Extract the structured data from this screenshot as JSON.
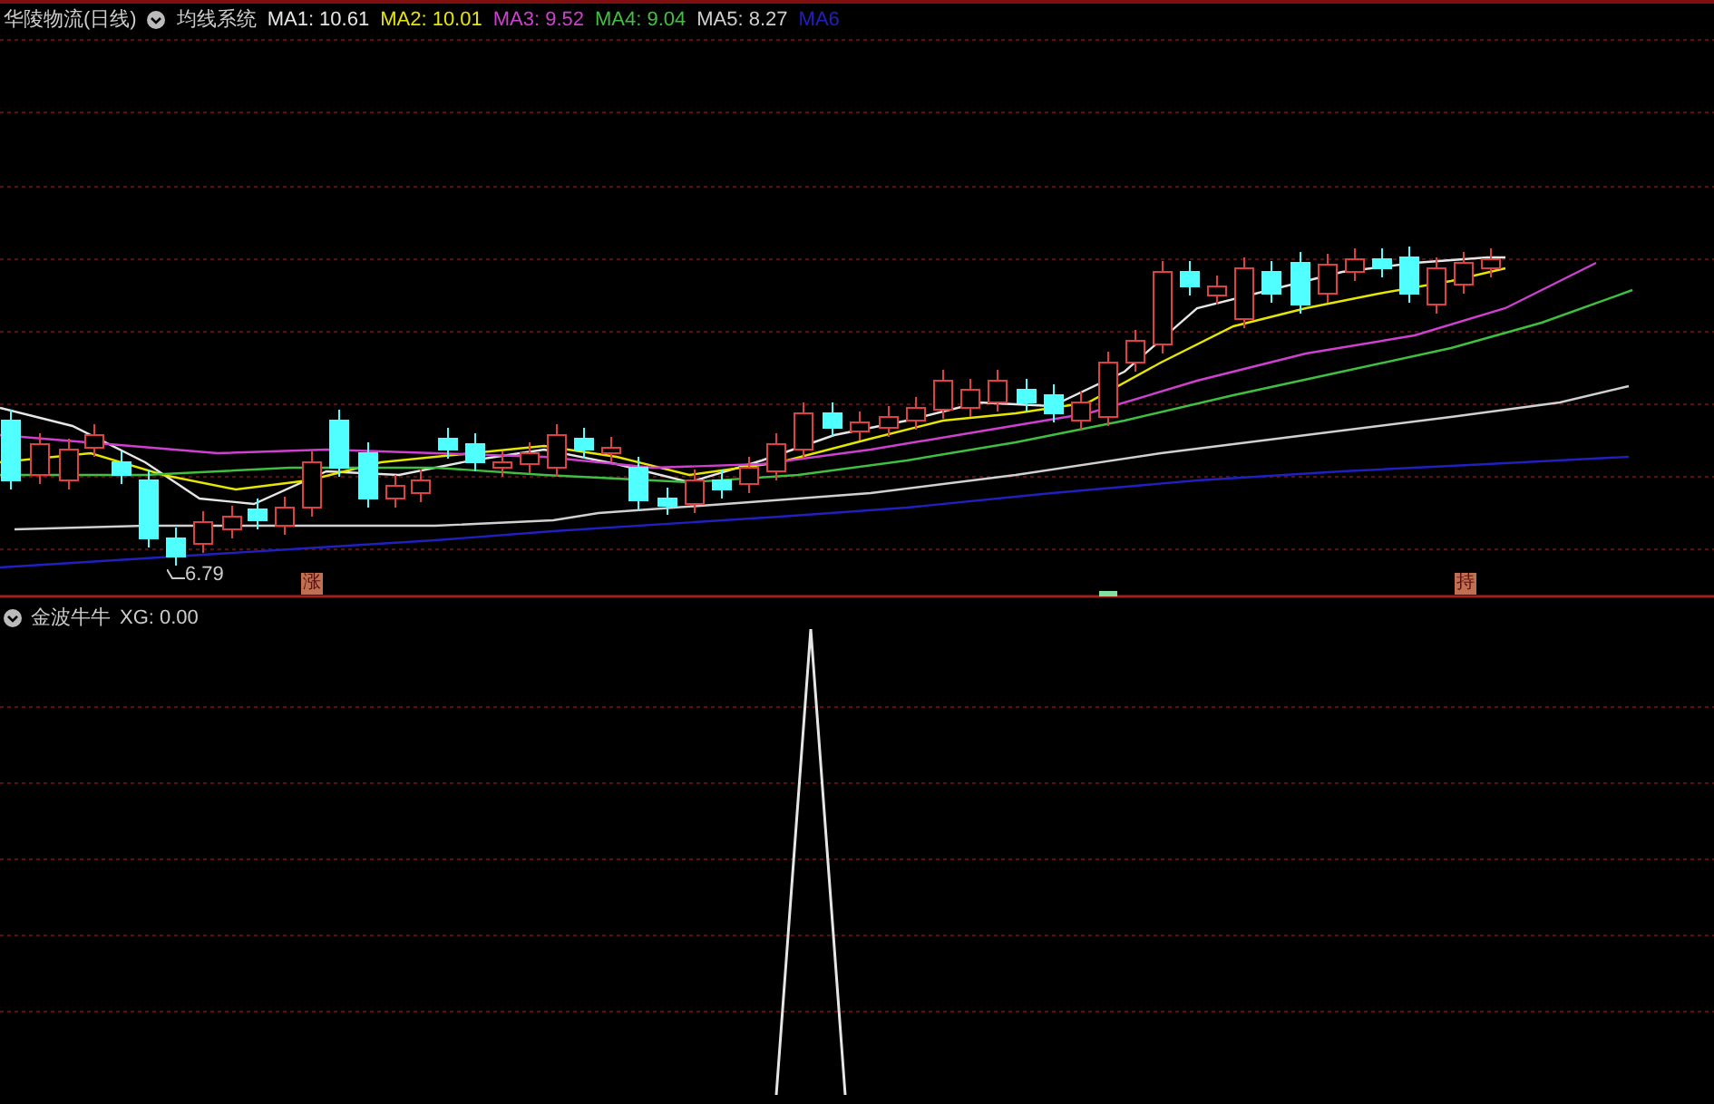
{
  "main_panel": {
    "title": "华陵物流(日线)",
    "indicator": "均线系统",
    "moving_averages": [
      {
        "label": "MA1: 10.61",
        "color": "#e6e6e6"
      },
      {
        "label": "MA2: 10.01",
        "color": "#e6e600"
      },
      {
        "label": "MA3: 9.52",
        "color": "#d040d0"
      },
      {
        "label": "MA4: 9.04",
        "color": "#40c040"
      },
      {
        "label": "MA5: 8.27",
        "color": "#d0d0d0"
      },
      {
        "label": "MA6",
        "color": "#2020c0"
      }
    ],
    "low_label": "6.79",
    "signal_marks": [
      {
        "label": "涨"
      },
      {
        "label": "持"
      }
    ]
  },
  "lower_panel": {
    "label": "金波牛牛",
    "reading": "XG: 0.00"
  }
}
